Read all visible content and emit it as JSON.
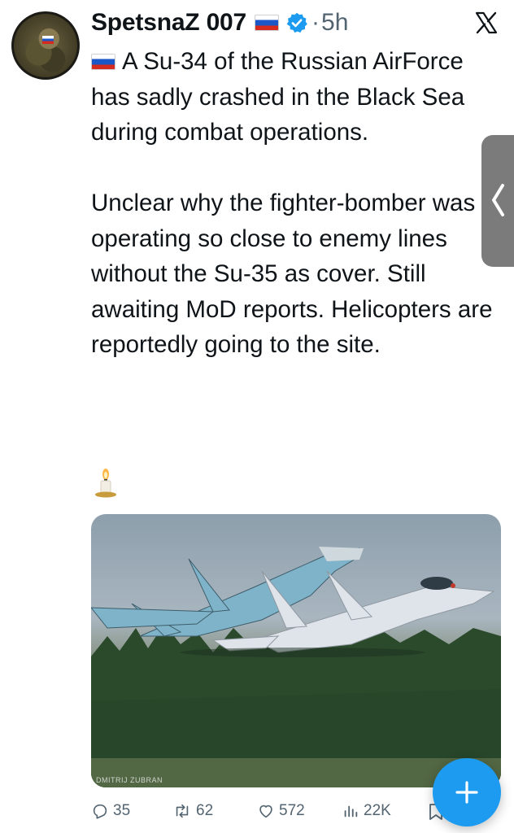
{
  "tweet": {
    "author": {
      "name": "SpetsnaZ 007",
      "flag_icon": "russia-flag-icon",
      "verified_icon": "verified-badge-icon"
    },
    "separator": "·",
    "time": "5h",
    "text_intro": "A Su-34 of the Russian AirForce has sadly crashed in the Black Sea during combat operations.",
    "text_body": "Unclear why the fighter-bomber was operating so close to enemy lines without the Su-35 as cover. Still awaiting MoD reports. Helicopters are reportedly going to the site.",
    "candle_icon": "candle-icon",
    "media": {
      "description_icon": "fighter-jets-photo",
      "watermark": "DMITRIJ ZUBRAN"
    },
    "stats": {
      "replies": "35",
      "reposts": "62",
      "likes": "572",
      "views": "22K"
    }
  },
  "colors": {
    "accent": "#1d9bf0",
    "muted": "#536471",
    "text": "#0f1419"
  }
}
